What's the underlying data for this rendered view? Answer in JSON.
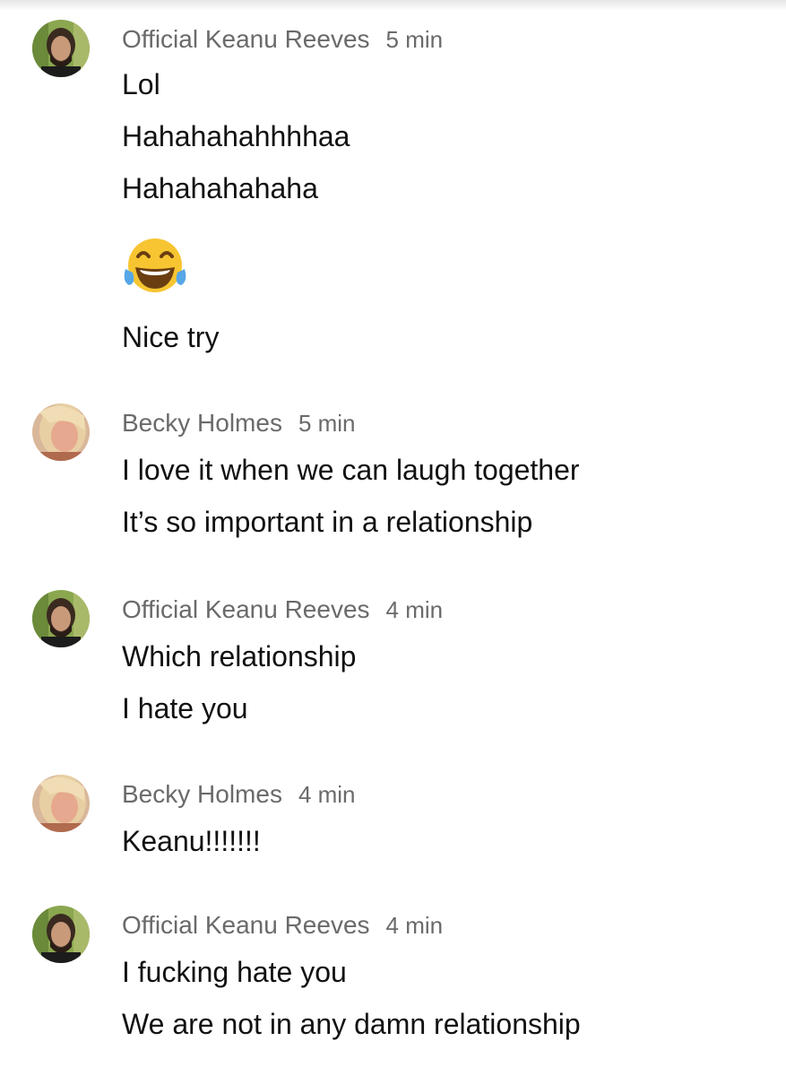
{
  "messages": [
    {
      "sender": "Official Keanu Reeves",
      "time": "5 min",
      "avatar": "keanu-avatar",
      "lines": [
        "Lol",
        "Hahahahahhhhaa",
        "Hahahahahaha",
        "Nice try"
      ],
      "emoji": "face-with-tears-of-joy-icon"
    },
    {
      "sender": "Becky Holmes",
      "time": "5 min",
      "avatar": "becky-avatar",
      "lines": [
        "I love it when we can laugh together",
        "It’s so important in a relationship"
      ]
    },
    {
      "sender": "Official Keanu Reeves",
      "time": "4 min",
      "avatar": "keanu-avatar",
      "lines": [
        "Which relationship",
        "I hate you"
      ]
    },
    {
      "sender": "Becky Holmes",
      "time": "4 min",
      "avatar": "becky-avatar",
      "lines": [
        "Keanu!!!!!!!"
      ]
    },
    {
      "sender": "Official Keanu Reeves",
      "time": "4 min",
      "avatar": "keanu-avatar",
      "lines": [
        "I fucking hate you",
        "We are not in any damn relationship"
      ]
    }
  ],
  "colors": {
    "text": "#111111",
    "meta": "#6a6a6a",
    "background": "#ffffff"
  }
}
